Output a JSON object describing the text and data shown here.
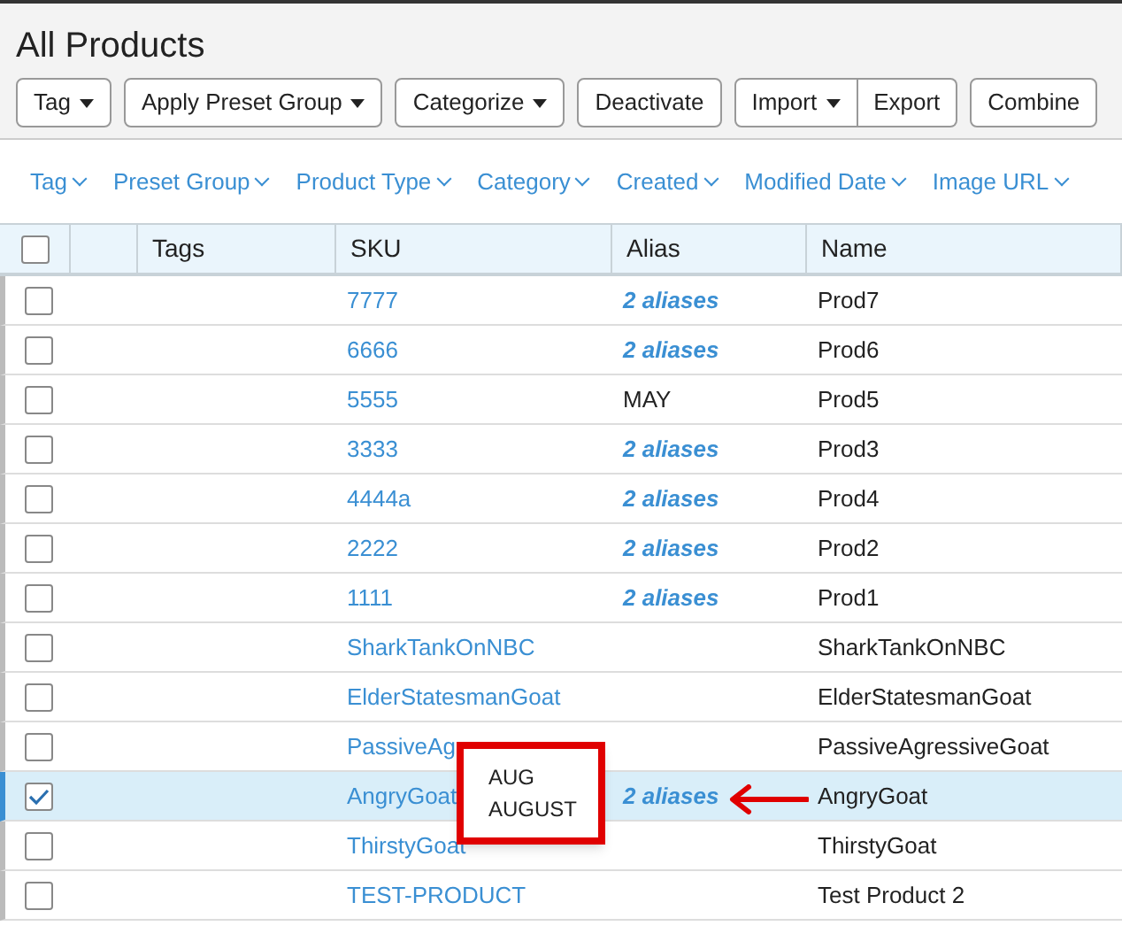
{
  "page": {
    "title": "All Products"
  },
  "toolbar": [
    {
      "label": "Tag",
      "dropdown": true
    },
    {
      "label": "Apply Preset Group",
      "dropdown": true
    },
    {
      "label": "Categorize",
      "dropdown": true
    },
    {
      "label": "Deactivate",
      "dropdown": false
    },
    {
      "group": [
        {
          "label": "Import",
          "dropdown": true
        },
        {
          "label": "Export",
          "dropdown": false
        }
      ]
    },
    {
      "label": "Combine",
      "dropdown": false
    }
  ],
  "filters": [
    "Tag",
    "Preset Group",
    "Product Type",
    "Category",
    "Created",
    "Modified Date",
    "Image URL"
  ],
  "table": {
    "columns": [
      "Tags",
      "SKU",
      "Alias",
      "Name"
    ],
    "select_all_checked": false,
    "rows": [
      {
        "sku": "7777",
        "alias": {
          "kind": "link",
          "text": "2 aliases"
        },
        "name": "Prod7",
        "checked": false
      },
      {
        "sku": "6666",
        "alias": {
          "kind": "link",
          "text": "2 aliases"
        },
        "name": "Prod6",
        "checked": false
      },
      {
        "sku": "5555",
        "alias": {
          "kind": "text",
          "text": "MAY"
        },
        "name": "Prod5",
        "checked": false
      },
      {
        "sku": "3333",
        "alias": {
          "kind": "link",
          "text": "2 aliases"
        },
        "name": "Prod3",
        "checked": false
      },
      {
        "sku": "4444a",
        "alias": {
          "kind": "link",
          "text": "2 aliases"
        },
        "name": "Prod4",
        "checked": false
      },
      {
        "sku": "2222",
        "alias": {
          "kind": "link",
          "text": "2 aliases"
        },
        "name": "Prod2",
        "checked": false
      },
      {
        "sku": "1111",
        "alias": {
          "kind": "link",
          "text": "2 aliases"
        },
        "name": "Prod1",
        "checked": false
      },
      {
        "sku": "SharkTankOnNBC",
        "name": "SharkTankOnNBC",
        "checked": false
      },
      {
        "sku": "ElderStatesmanGoat",
        "name": "ElderStatesmanGoat",
        "checked": false
      },
      {
        "sku": "PassiveAg",
        "name": "PassiveAgressiveGoat",
        "checked": false
      },
      {
        "sku": "AngryGoat",
        "alias": {
          "kind": "link",
          "text": "2 aliases",
          "popover": [
            "AUG",
            "AUGUST"
          ]
        },
        "name": "AngryGoat",
        "checked": true
      },
      {
        "sku": "ThirstyGoat",
        "name": "ThirstyGoat",
        "checked": false
      },
      {
        "sku": "TEST-PRODUCT",
        "name": "Test Product 2",
        "checked": false
      }
    ]
  }
}
